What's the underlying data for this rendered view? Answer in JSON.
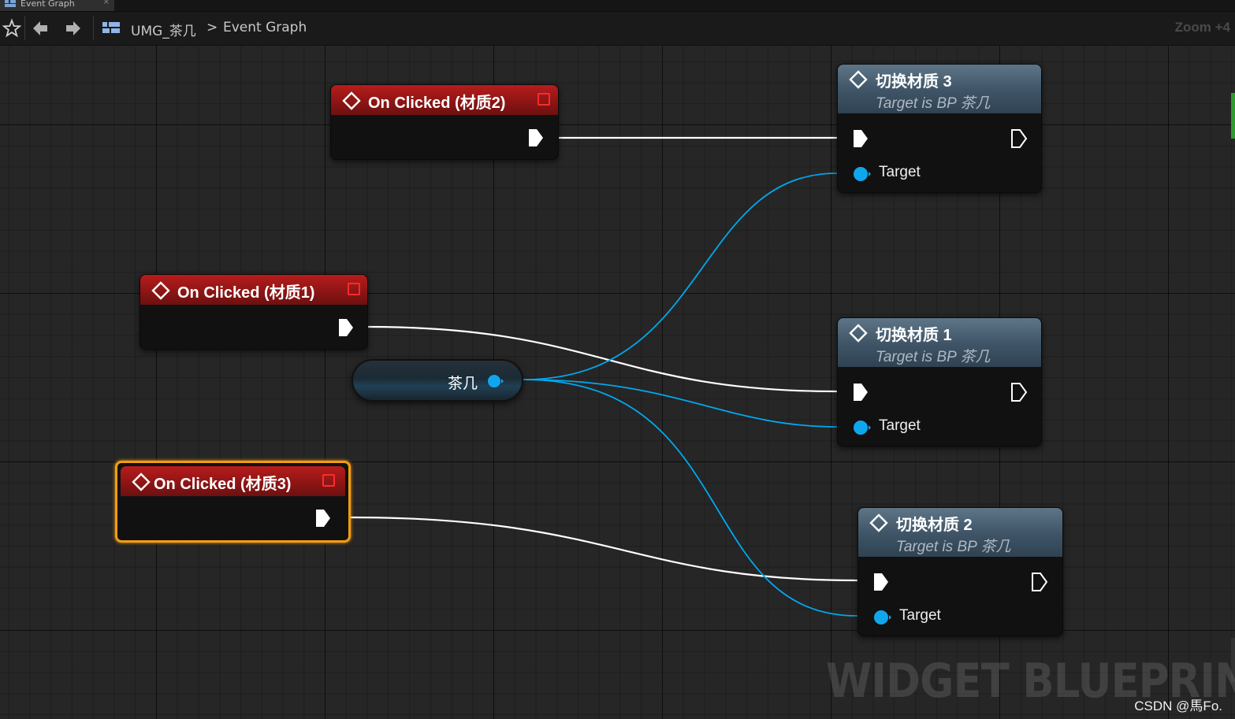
{
  "tab": {
    "label": "Event Graph",
    "close": "×"
  },
  "toolbar": {
    "breadcrumb_asset": "UMG_茶几",
    "breadcrumb_separator": ">",
    "breadcrumb_graph": "Event Graph",
    "zoom": "Zoom +4"
  },
  "events": [
    {
      "title": "On Clicked (材质2)"
    },
    {
      "title": "On Clicked (材质1)"
    },
    {
      "title": "On Clicked (材质3)"
    }
  ],
  "functions": [
    {
      "title": "切换材质 3",
      "subtitle": "Target is BP 茶几",
      "pin_label": "Target"
    },
    {
      "title": "切换材质 1",
      "subtitle": "Target is BP 茶几",
      "pin_label": "Target"
    },
    {
      "title": "切换材质 2",
      "subtitle": "Target is BP 茶几",
      "pin_label": "Target"
    }
  ],
  "variable": {
    "label": "茶几"
  },
  "watermark": "WIDGET BLUEPRINT",
  "credit": "CSDN @馬Fo.",
  "colors": {
    "exec_wire": "#ffffff",
    "object_wire": "#00a8f0",
    "event_header": "#a31818",
    "function_header": "#4a6273",
    "selection": "#f39c12",
    "delegate_pin": "#ff2b2b"
  }
}
